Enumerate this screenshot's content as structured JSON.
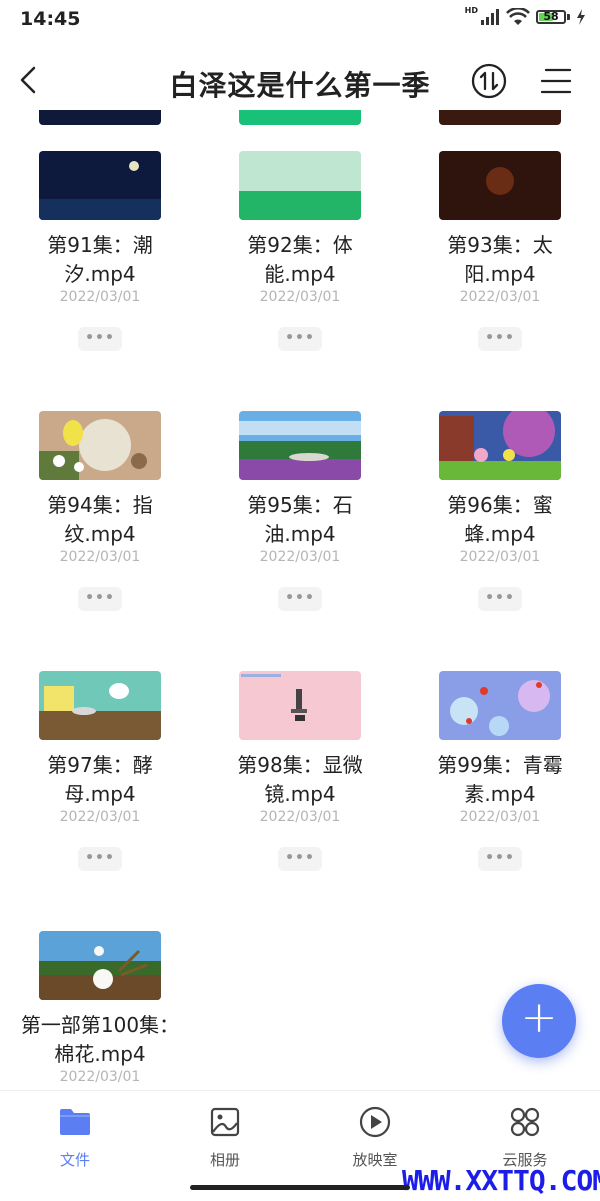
{
  "status": {
    "time": "14:45",
    "network": "HD",
    "battery": "58",
    "battery_level": 0.58
  },
  "header": {
    "title": "白泽这是什么第一季",
    "sort_icon": "sort-icon",
    "menu_icon": "menu-icon",
    "back_icon": "back-arrow-icon"
  },
  "files": [
    {
      "name": "",
      "date": "",
      "thumb": "partial-dark"
    },
    {
      "name": "",
      "date": "",
      "thumb": "partial-green"
    },
    {
      "name": "",
      "date": "",
      "thumb": "partial-brown"
    },
    {
      "name": "第91集：潮汐.mp4",
      "date": "2022/03/01",
      "thumb": "night-sea"
    },
    {
      "name": "第92集：体能.mp4",
      "date": "2022/03/01",
      "thumb": "green-field"
    },
    {
      "name": "第93集：太阳.mp4",
      "date": "2022/03/01",
      "thumb": "dark-brown"
    },
    {
      "name": "第94集：指纹.mp4",
      "date": "2022/03/01",
      "thumb": "egg-garden"
    },
    {
      "name": "第95集：石油.mp4",
      "date": "2022/03/01",
      "thumb": "sky-flowers"
    },
    {
      "name": "第96集：蜜蜂.mp4",
      "date": "2022/03/01",
      "thumb": "purple-tree"
    },
    {
      "name": "第97集：酵母.mp4",
      "date": "2022/03/01",
      "thumb": "kitchen"
    },
    {
      "name": "第98集：显微镜.mp4",
      "date": "2022/03/01",
      "thumb": "microscope"
    },
    {
      "name": "第99集：青霉素.mp4",
      "date": "2022/03/01",
      "thumb": "blue-bubbles"
    },
    {
      "name": "第一部第100集：棉花.mp4",
      "date": "2022/03/01",
      "thumb": "cotton-field"
    }
  ],
  "more_label": "•••",
  "fab": {
    "label": "+",
    "icon": "add-icon"
  },
  "nav": [
    {
      "label": "文件",
      "icon": "folder-icon",
      "active": true
    },
    {
      "label": "相册",
      "icon": "photo-album-icon",
      "active": false
    },
    {
      "label": "放映室",
      "icon": "play-icon",
      "active": false
    },
    {
      "label": "云服务",
      "icon": "cloud-service-icon",
      "active": false
    }
  ],
  "watermark": "WWW.XXTTQ.COM",
  "colors": {
    "accent": "#5b7ff2",
    "watermark": "#1d1de8"
  }
}
